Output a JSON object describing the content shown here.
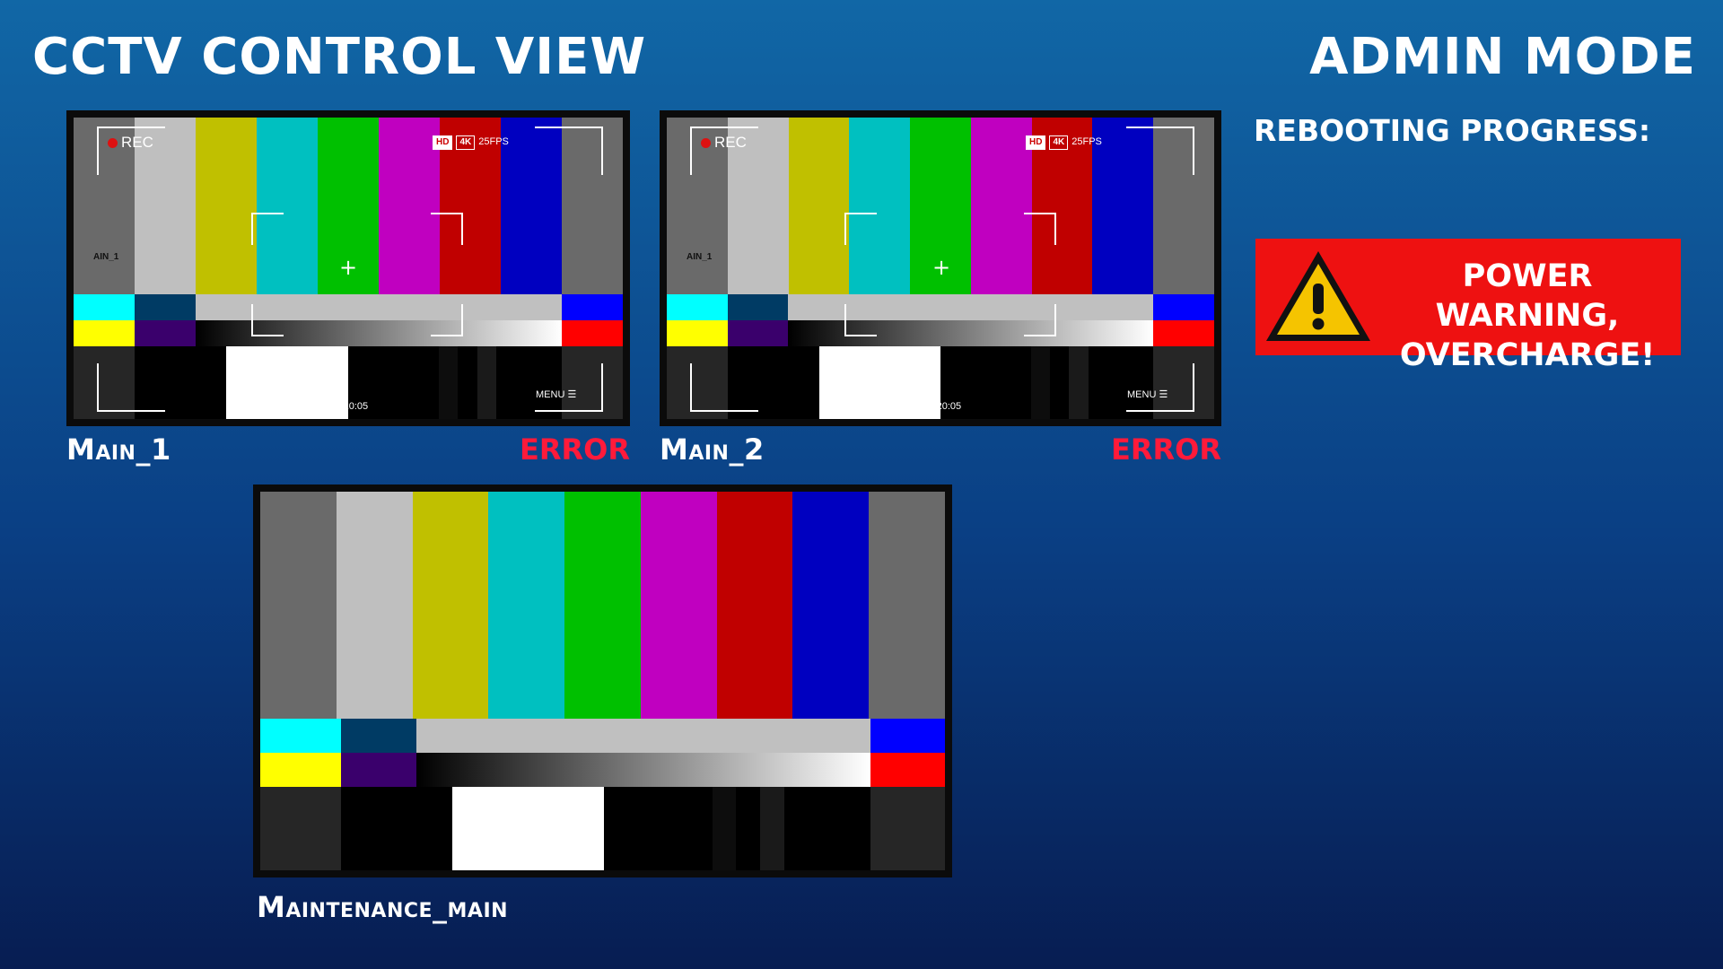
{
  "header": {
    "title": "CCTV CONTROL VIEW",
    "mode": "ADMIN MODE"
  },
  "status": {
    "rebooting_label": "REBOOTING PROGRESS:"
  },
  "warning": {
    "icon": "warning-triangle-icon",
    "line1": "POWER WARNING,",
    "line2": "OVERCHARGE!",
    "color": "#ee1111"
  },
  "cameras": [
    {
      "label": "Main_1",
      "status": "ERROR",
      "rec": "REC",
      "hd": "HD",
      "res": "4K",
      "fps": "25FPS",
      "timecode": "00:00:20:05",
      "menu": "MENU",
      "overlay_label": "AIN_1"
    },
    {
      "label": "Main_2",
      "status": "ERROR",
      "rec": "REC",
      "hd": "HD",
      "res": "4K",
      "fps": "25FPS",
      "timecode": "00:00:20:05",
      "menu": "MENU",
      "overlay_label": "AIN_1"
    }
  ],
  "maintenance": {
    "label": "Maintenance_main"
  },
  "colors": {
    "error": "#ff1a3a",
    "background_top": "#1167a6",
    "background_bottom": "#071d52"
  }
}
